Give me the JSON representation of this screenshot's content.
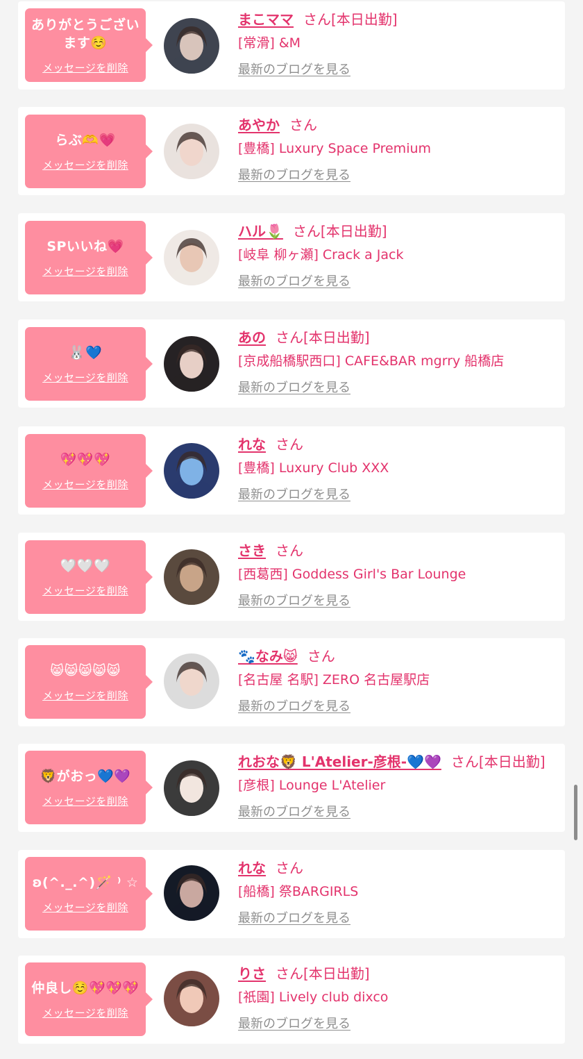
{
  "common": {
    "delete_label": "メッセージを削除",
    "san_label": "さん",
    "blog_label": "最新のブログを見る"
  },
  "colors": {
    "bubble": "#fe8ea0",
    "accent": "#e3336c",
    "muted": "#8e8e8e"
  },
  "items": [
    {
      "message": "ありがとうございます☺️",
      "name": "まこママ",
      "status": "[本日出勤]",
      "shop": "[常滑] &M"
    },
    {
      "message": "らぶ🫶💗",
      "name": "あやか",
      "status": "",
      "shop": "[豊橋] Luxury Space Premium"
    },
    {
      "message": "SPいいね💗",
      "name": "ハル🌷",
      "status": "[本日出勤]",
      "shop": "[岐阜 柳ヶ瀬] Crack a Jack"
    },
    {
      "message": "🐰💙",
      "name": "あの",
      "status": "[本日出勤]",
      "shop": "[京成船橋駅西口] CAFE&BAR mgrry 船橋店"
    },
    {
      "message": "💖💖💖",
      "name": "れな",
      "status": "",
      "shop": "[豊橋] Luxury Club XXX"
    },
    {
      "message": "🤍🤍🤍",
      "name": "さき",
      "status": "",
      "shop": "[西葛西] Goddess Girl's Bar Lounge"
    },
    {
      "message": "😸😸😸😸😸",
      "name": "🐾なみ😸",
      "status": "",
      "shop": "[名古屋 名駅] ZERO 名古屋駅店"
    },
    {
      "message": "🦁がおっ💙💜",
      "name": "れおな🦁 L'Atelier-彦根-💙💜",
      "status": "[本日出勤]",
      "shop": "[彦根] Lounge L'Atelier"
    },
    {
      "message": "ʚ(^._.^)🪄 ⁾ ☆",
      "name": "れな",
      "status": "",
      "shop": "[船橋] 祭BARGIRLS"
    },
    {
      "message": "仲良し☺️💖💖💖",
      "name": "りさ",
      "status": "[本日出勤]",
      "shop": "[祇園] Lively club dixco"
    }
  ]
}
